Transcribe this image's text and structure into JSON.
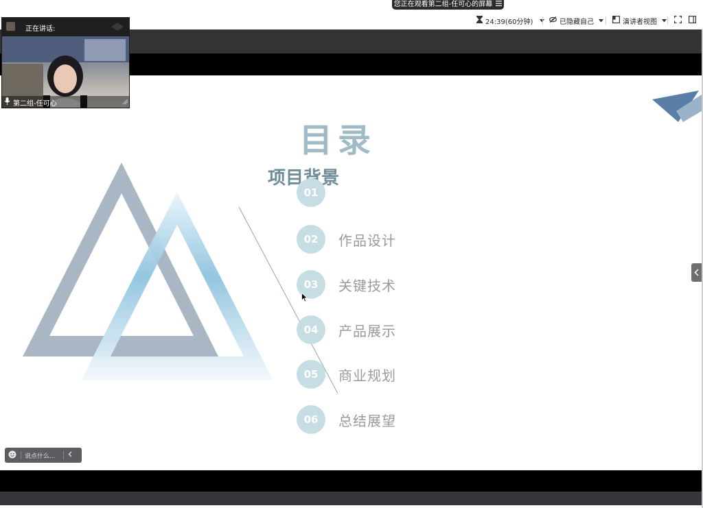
{
  "banner": {
    "text": "您正在观看第二组-任可心的屏幕",
    "icon": "menu-lines-icon"
  },
  "toolbar": {
    "timer": "24:39(60分钟)",
    "timer_icon": "hourglass-icon",
    "hide_self": "已隐藏自己",
    "hide_icon": "eye-off-icon",
    "view_mode": "演讲者视图",
    "view_icon": "presenter-view-icon",
    "fullscreen_icon": "fullscreen-icon",
    "sidebar_icon": "sidebar-toggle-icon"
  },
  "video": {
    "speaking_label": "正在讲话:",
    "participant_name": "第二组-任可心",
    "mic_icon": "microphone-icon"
  },
  "slide": {
    "title": "目录",
    "first_item_text": "项目背景",
    "items": [
      {
        "num": "01",
        "label": ""
      },
      {
        "num": "02",
        "label": "作品设计"
      },
      {
        "num": "03",
        "label": "关键技术"
      },
      {
        "num": "04",
        "label": "产品展示"
      },
      {
        "num": "05",
        "label": "商业规划"
      },
      {
        "num": "06",
        "label": "总结展望"
      }
    ],
    "colors": {
      "title": "#9fbcc6",
      "heading": "#6f8d99",
      "circle": "#c7dde4",
      "label": "#9a9a9a",
      "triangle_gray": "#a9b6c3",
      "triangle_blue": "#8ec3de",
      "corner_dark": "#5a7fa6",
      "corner_light": "#9bb2c9"
    }
  },
  "chat": {
    "placeholder": "说点什么...",
    "emoji_icon": "emoji-icon",
    "collapse_icon": "chevron-left-icon"
  },
  "side_panel": {
    "toggle_icon": "chevron-left-icon"
  }
}
